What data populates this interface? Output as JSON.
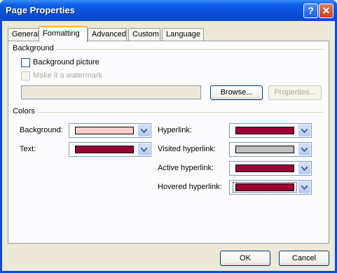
{
  "window": {
    "title": "Page Properties"
  },
  "tabs": [
    {
      "label": "General"
    },
    {
      "label": "Formatting"
    },
    {
      "label": "Advanced"
    },
    {
      "label": "Custom"
    },
    {
      "label": "Language"
    }
  ],
  "background": {
    "group_label": "Background",
    "bg_picture_label": "Background picture",
    "bg_picture_checked": false,
    "watermark_label": "Make it a watermark",
    "watermark_checked": false,
    "watermark_enabled": false,
    "picture_path": "",
    "browse_label": "Browse...",
    "properties_label": "Properties..."
  },
  "colors": {
    "group_label": "Colors",
    "background": {
      "label": "Background:",
      "color": "#ffcccc"
    },
    "text": {
      "label": "Text:",
      "color": "#990033"
    },
    "hyperlink": {
      "label": "Hyperlink:",
      "color": "#990033"
    },
    "visited": {
      "label": "Visited hyperlink:",
      "color": "#c0c0c0"
    },
    "active": {
      "label": "Active hyperlink:",
      "color": "#990033"
    },
    "hovered": {
      "label": "Hovered hyperlink:",
      "color": "#990033"
    }
  },
  "footer": {
    "ok_label": "OK",
    "cancel_label": "Cancel"
  }
}
